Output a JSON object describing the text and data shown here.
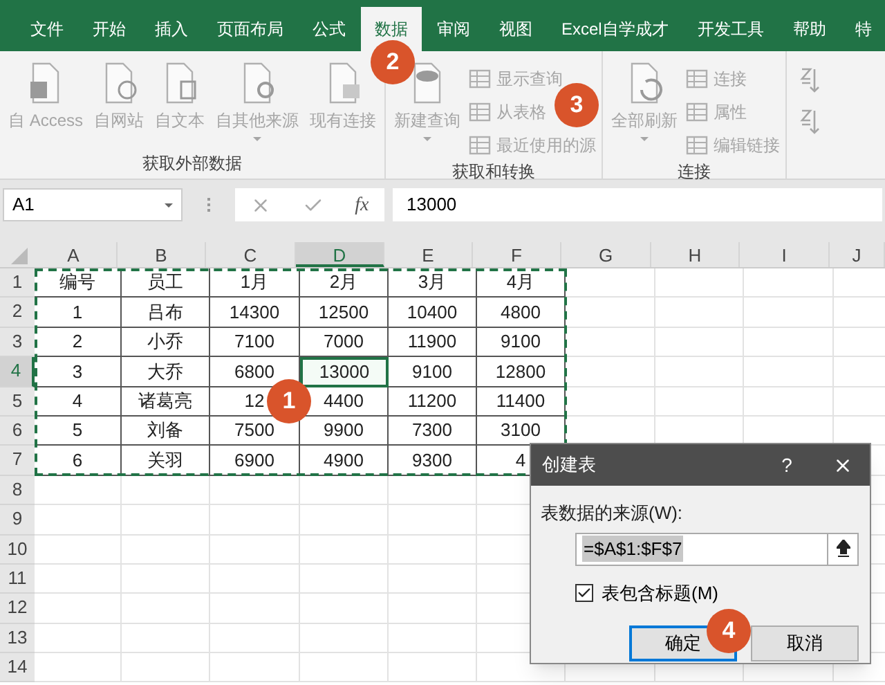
{
  "ribbon_tabs": [
    {
      "label": "文件",
      "selected": false
    },
    {
      "label": "开始",
      "selected": false
    },
    {
      "label": "插入",
      "selected": false
    },
    {
      "label": "页面布局",
      "selected": false
    },
    {
      "label": "公式",
      "selected": false
    },
    {
      "label": "数据",
      "selected": true
    },
    {
      "label": "审阅",
      "selected": false
    },
    {
      "label": "视图",
      "selected": false
    },
    {
      "label": "Excel自学成才",
      "selected": false
    },
    {
      "label": "开发工具",
      "selected": false
    },
    {
      "label": "帮助",
      "selected": false
    },
    {
      "label": "特",
      "selected": false
    }
  ],
  "ribbon_groups": [
    {
      "label": "获取外部数据",
      "large_buttons": [
        {
          "label": "自 Access",
          "kind": "access"
        },
        {
          "label": "自网站",
          "kind": "web"
        },
        {
          "label": "自文本",
          "kind": "text"
        },
        {
          "label": "自其他来源",
          "kind": "other",
          "dropdown": true
        },
        {
          "label": "现有连接",
          "kind": "existing"
        }
      ]
    },
    {
      "label": "获取和转换",
      "large_buttons": [
        {
          "label": "新建查询",
          "kind": "query",
          "dropdown": true
        }
      ],
      "small_buttons": [
        "显示查询",
        "从表格",
        "最近使用的源"
      ]
    },
    {
      "label": "连接",
      "large_buttons": [
        {
          "label": "全部刷新",
          "kind": "refresh",
          "dropdown": true
        }
      ],
      "small_buttons": [
        "连接",
        "属性",
        "编辑链接"
      ]
    }
  ],
  "formula_bar": {
    "name_box": "A1",
    "function_label": "fx",
    "value": "13000"
  },
  "columns": [
    {
      "label": "A",
      "selected": false
    },
    {
      "label": "B",
      "selected": false
    },
    {
      "label": "C",
      "selected": false
    },
    {
      "label": "D",
      "selected": true
    },
    {
      "label": "E",
      "selected": false
    },
    {
      "label": "F",
      "selected": false
    },
    {
      "label": "G",
      "selected": false
    },
    {
      "label": "H",
      "selected": false
    },
    {
      "label": "I",
      "selected": false
    },
    {
      "label": "J",
      "selected": false
    }
  ],
  "rows": [
    {
      "header": "1",
      "selected": false,
      "cells": [
        {
          "text": "编号",
          "selected": false
        },
        {
          "text": "员工",
          "selected": false
        },
        {
          "text": "1月",
          "selected": false
        },
        {
          "text": "2月",
          "selected": false
        },
        {
          "text": "3月",
          "selected": false
        },
        {
          "text": "4月",
          "selected": false
        }
      ]
    },
    {
      "header": "2",
      "selected": false,
      "cells": [
        {
          "text": "1",
          "selected": false
        },
        {
          "text": "吕布",
          "selected": false
        },
        {
          "text": "14300",
          "selected": false
        },
        {
          "text": "12500",
          "selected": false
        },
        {
          "text": "10400",
          "selected": false
        },
        {
          "text": "4800",
          "selected": false
        }
      ]
    },
    {
      "header": "3",
      "selected": false,
      "cells": [
        {
          "text": "2",
          "selected": false
        },
        {
          "text": "小乔",
          "selected": false
        },
        {
          "text": "7100",
          "selected": false
        },
        {
          "text": "7000",
          "selected": false
        },
        {
          "text": "11900",
          "selected": false
        },
        {
          "text": "9100",
          "selected": false
        }
      ]
    },
    {
      "header": "4",
      "selected": true,
      "cells": [
        {
          "text": "3",
          "selected": false
        },
        {
          "text": "大乔",
          "selected": false
        },
        {
          "text": "6800",
          "selected": false
        },
        {
          "text": "13000",
          "selected": true
        },
        {
          "text": "9100",
          "selected": false
        },
        {
          "text": "12800",
          "selected": false
        }
      ]
    },
    {
      "header": "5",
      "selected": false,
      "cells": [
        {
          "text": "4",
          "selected": false
        },
        {
          "text": "诸葛亮",
          "selected": false
        },
        {
          "text": "12",
          "selected": false
        },
        {
          "text": "4400",
          "selected": false
        },
        {
          "text": "11200",
          "selected": false
        },
        {
          "text": "11400",
          "selected": false
        }
      ]
    },
    {
      "header": "6",
      "selected": false,
      "cells": [
        {
          "text": "5",
          "selected": false
        },
        {
          "text": "刘备",
          "selected": false
        },
        {
          "text": "7500",
          "selected": false
        },
        {
          "text": "9900",
          "selected": false
        },
        {
          "text": "7300",
          "selected": false
        },
        {
          "text": "3100",
          "selected": false
        }
      ]
    },
    {
      "header": "7",
      "selected": false,
      "cells": [
        {
          "text": "6",
          "selected": false
        },
        {
          "text": "关羽",
          "selected": false
        },
        {
          "text": "6900",
          "selected": false
        },
        {
          "text": "4900",
          "selected": false
        },
        {
          "text": "9300",
          "selected": false
        },
        {
          "text": "4",
          "selected": false
        }
      ]
    },
    {
      "header": "8",
      "selected": false,
      "cells": []
    },
    {
      "header": "9",
      "selected": false,
      "cells": []
    },
    {
      "header": "10",
      "selected": false,
      "cells": []
    },
    {
      "header": "11",
      "selected": false,
      "cells": []
    },
    {
      "header": "12",
      "selected": false,
      "cells": []
    },
    {
      "header": "13",
      "selected": false,
      "cells": []
    },
    {
      "header": "14",
      "selected": false,
      "cells": []
    }
  ],
  "dialog": {
    "title": "创建表",
    "help": "?",
    "source_label": "表数据的来源(W):",
    "source_value": "=$A$1:$F$7",
    "checkbox": {
      "label": "表包含标题(M)",
      "checked": true
    },
    "buttons": [
      {
        "label": "确定",
        "default": true
      },
      {
        "label": "取消",
        "default": false
      }
    ]
  },
  "badges": [
    "1",
    "2",
    "3",
    "4"
  ]
}
